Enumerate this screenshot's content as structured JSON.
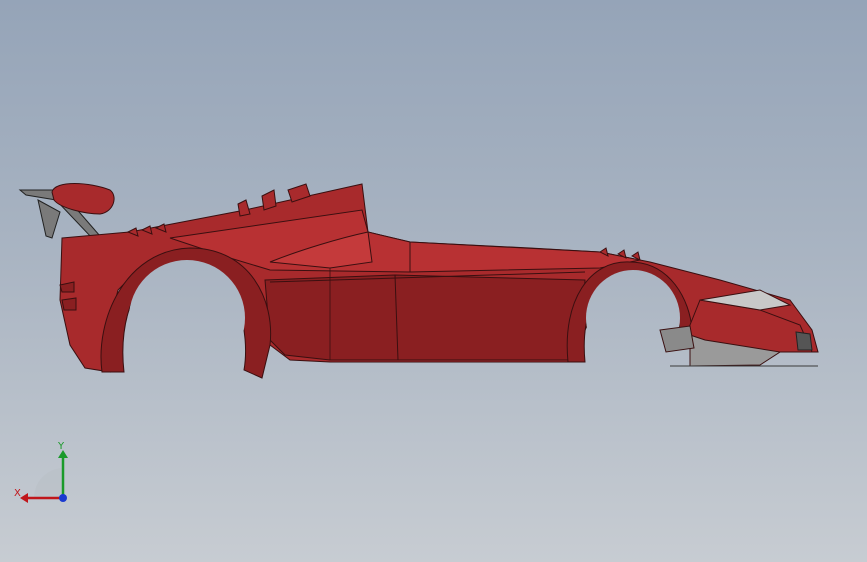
{
  "viewport": {
    "background_top": "#95a4b8",
    "background_bottom": "#c7ccd2"
  },
  "model": {
    "body_color": "#a82a2c",
    "body_shadow": "#8a1f21",
    "body_highlight": "#c43a3b",
    "edge_color": "#3a0f10",
    "trim_color": "#9a9a9a"
  },
  "triad": {
    "x_label": "X",
    "y_label": "Y",
    "x_color": "#c0161b",
    "y_color": "#1a9a2a",
    "z_color": "#1a3ad0"
  }
}
